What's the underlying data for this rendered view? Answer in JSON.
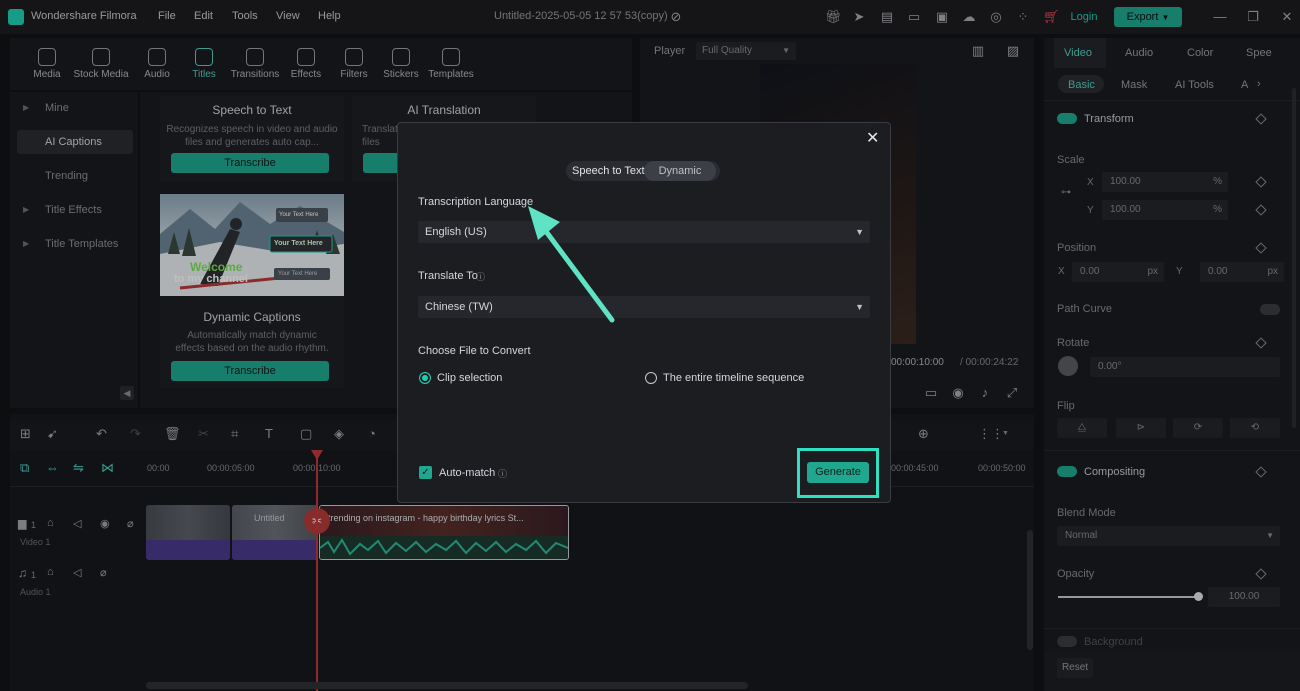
{
  "app": {
    "name": "Wondershare Filmora",
    "menus": [
      "File",
      "Edit",
      "Tools",
      "View",
      "Help"
    ],
    "project_title": "Untitled-2025-05-05 12 57 53(copy)",
    "login": "Login",
    "export": "Export"
  },
  "toolbar": {
    "items": [
      {
        "label": "Media",
        "icon": "media-icon"
      },
      {
        "label": "Stock Media",
        "icon": "stock-media-icon"
      },
      {
        "label": "Audio",
        "icon": "audio-icon"
      },
      {
        "label": "Titles",
        "icon": "titles-icon"
      },
      {
        "label": "Transitions",
        "icon": "transitions-icon"
      },
      {
        "label": "Effects",
        "icon": "effects-icon"
      },
      {
        "label": "Filters",
        "icon": "filters-icon"
      },
      {
        "label": "Stickers",
        "icon": "stickers-icon"
      },
      {
        "label": "Templates",
        "icon": "templates-icon"
      }
    ]
  },
  "sidebar": {
    "items": [
      {
        "label": "Mine",
        "caret": true
      },
      {
        "label": "AI Captions",
        "caret": false
      },
      {
        "label": "Trending",
        "caret": false
      },
      {
        "label": "Title Effects",
        "caret": true
      },
      {
        "label": "Title Templates",
        "caret": true
      }
    ]
  },
  "cards": {
    "stt": {
      "title": "Speech to Text",
      "desc": "Recognizes speech in video and audio files and generates auto cap...",
      "button": "Transcribe"
    },
    "ai_translation": {
      "title": "AI Translation",
      "desc_partial": "Translat files"
    },
    "dynamic": {
      "title": "Dynamic Captions",
      "desc": "Automatically match dynamic effects based on the audio rhythm.",
      "button": "Transcribe"
    },
    "thumb_texts": {
      "tag1": "Your Text Here",
      "tag2": "Your Text Here",
      "tag3": "Your Text Here",
      "welcome": "Welcome",
      "channel": "to my channel"
    }
  },
  "player": {
    "label": "Player",
    "quality": "Full Quality",
    "current_time": "00:00:10:00",
    "total_time": "/ 00:00:24:22"
  },
  "right_panel": {
    "tabs": [
      "Video",
      "Audio",
      "Color",
      "Spee"
    ],
    "subtabs": [
      "Basic",
      "Mask",
      "AI Tools",
      "A"
    ],
    "transform": "Transform",
    "scale": "Scale",
    "scale_x_label": "X",
    "scale_x": "100.00",
    "scale_x_unit": "%",
    "scale_y_label": "Y",
    "scale_y": "100.00",
    "scale_y_unit": "%",
    "position": "Position",
    "pos_x_label": "X",
    "pos_x": "0.00",
    "pos_x_unit": "px",
    "pos_y_label": "Y",
    "pos_y": "0.00",
    "pos_y_unit": "px",
    "path_curve": "Path Curve",
    "rotate": "Rotate",
    "rotate_value": "0.00°",
    "flip": "Flip",
    "compositing": "Compositing",
    "blend_mode": "Blend Mode",
    "blend_value": "Normal",
    "opacity": "Opacity",
    "opacity_value": "100.00",
    "opacity_level": 1.0,
    "background": "Background",
    "reset": "Reset"
  },
  "dialog": {
    "seg_stt": "Speech to Text",
    "seg_dynamic": "Dynamic Captions",
    "transcription_label": "Transcription Language",
    "transcription_value": "English (US)",
    "translate_label": "Translate To",
    "translate_value": "Chinese (TW)",
    "choose_label": "Choose File to Convert",
    "opt_clip": "Clip selection",
    "opt_timeline": "The entire timeline sequence",
    "auto_match": "Auto-match",
    "generate": "Generate"
  },
  "timeline": {
    "ruler": [
      "00:00",
      "00:00:05:00",
      "00:00:10:00",
      "00:00:45:00",
      "00:00:50:00"
    ],
    "tracks": [
      {
        "num": "1",
        "label": "Video 1"
      },
      {
        "num": "1",
        "label": "Audio 1"
      }
    ],
    "clips": [
      "",
      "Untitled",
      "trending on instagram - happy birthday lyrics St..."
    ]
  },
  "colors": {
    "accent": "#1fa88f",
    "highlight": "#2fe0c2",
    "arrow": "#5fe3c4"
  }
}
